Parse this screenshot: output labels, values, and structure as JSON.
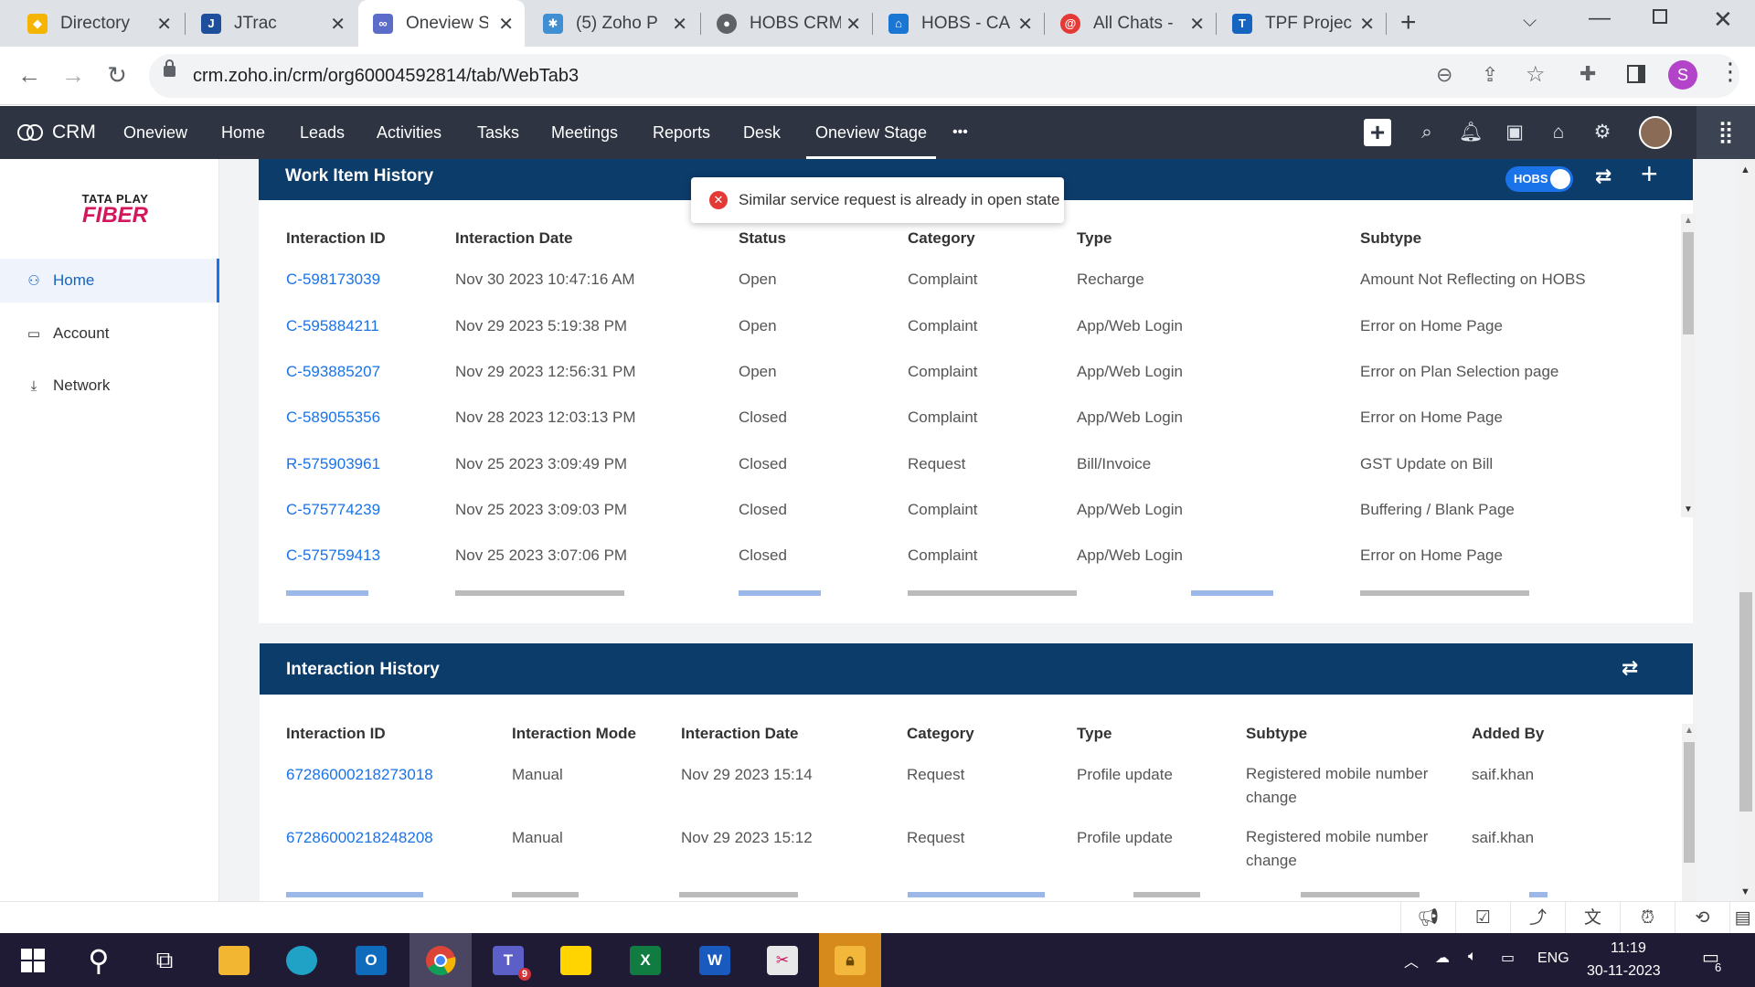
{
  "browser": {
    "tabs": [
      {
        "title": "Directory",
        "color": "#f4b400",
        "glyph": "◆"
      },
      {
        "title": "JTrac",
        "color": "#1e4f9c",
        "glyph": "J"
      },
      {
        "title": "Oneview S",
        "color": "#5b6cc9",
        "glyph": "∞",
        "active": true
      },
      {
        "title": "(5) Zoho P",
        "color": "#3f8fd2",
        "glyph": "✱"
      },
      {
        "title": "HOBS CRM",
        "color": "#5f6368",
        "glyph": "●"
      },
      {
        "title": "HOBS - CA",
        "color": "#1976d2",
        "glyph": "⌂"
      },
      {
        "title": "All Chats -",
        "color": "#e53935",
        "glyph": "@"
      },
      {
        "title": "TPF Projec",
        "color": "#1565c0",
        "glyph": "T"
      }
    ],
    "url": "crm.zoho.in/crm/org60004592814/tab/WebTab3",
    "profile_initial": "S"
  },
  "crm_nav": {
    "brand": "CRM",
    "items": [
      "Oneview",
      "Home",
      "Leads",
      "Activities",
      "Tasks",
      "Meetings",
      "Reports",
      "Desk",
      "Oneview Stage"
    ],
    "active": "Oneview Stage",
    "more": "•••"
  },
  "sidebar": {
    "logo_line1": "TATA PLAY",
    "logo_line2": "FIBER",
    "items": [
      {
        "label": "Home",
        "icon": "user-icon",
        "active": true
      },
      {
        "label": "Account",
        "icon": "account-icon"
      },
      {
        "label": "Network",
        "icon": "network-icon"
      }
    ]
  },
  "toast": {
    "message": "Similar service request is already in open state"
  },
  "work_item_history": {
    "title": "Work Item History",
    "toggle_label": "HOBS",
    "columns": [
      "Interaction ID",
      "Interaction Date",
      "Status",
      "Category",
      "Type",
      "Subtype"
    ],
    "rows": [
      {
        "id": "C-598173039",
        "date": "Nov 30 2023 10:47:16 AM",
        "status": "Open",
        "category": "Complaint",
        "type": "Recharge",
        "subtype": "Amount Not Reflecting on HOBS"
      },
      {
        "id": "C-595884211",
        "date": "Nov 29 2023 5:19:38 PM",
        "status": "Open",
        "category": "Complaint",
        "type": "App/Web Login",
        "subtype": "Error on Home Page"
      },
      {
        "id": "C-593885207",
        "date": "Nov 29 2023 12:56:31 PM",
        "status": "Open",
        "category": "Complaint",
        "type": "App/Web Login",
        "subtype": "Error on Plan Selection page"
      },
      {
        "id": "C-589055356",
        "date": "Nov 28 2023 12:03:13 PM",
        "status": "Closed",
        "category": "Complaint",
        "type": "App/Web Login",
        "subtype": "Error on Home Page"
      },
      {
        "id": "R-575903961",
        "date": "Nov 25 2023 3:09:49 PM",
        "status": "Closed",
        "category": "Request",
        "type": "Bill/Invoice",
        "subtype": "GST Update on Bill"
      },
      {
        "id": "C-575774239",
        "date": "Nov 25 2023 3:09:03 PM",
        "status": "Closed",
        "category": "Complaint",
        "type": "App/Web Login",
        "subtype": "Buffering / Blank Page"
      },
      {
        "id": "C-575759413",
        "date": "Nov 25 2023 3:07:06 PM",
        "status": "Closed",
        "category": "Complaint",
        "type": "App/Web Login",
        "subtype": "Error on Home Page"
      }
    ]
  },
  "interaction_history": {
    "title": "Interaction History",
    "columns": [
      "Interaction ID",
      "Interaction Mode",
      "Interaction Date",
      "Category",
      "Type",
      "Subtype",
      "Added By"
    ],
    "rows": [
      {
        "id": "67286000218273018",
        "mode": "Manual",
        "date": "Nov 29 2023 15:14",
        "category": "Request",
        "type": "Profile update",
        "subtype": "Registered mobile number change",
        "added_by": "saif.khan"
      },
      {
        "id": "67286000218248208",
        "mode": "Manual",
        "date": "Nov 29 2023 15:12",
        "category": "Request",
        "type": "Profile update",
        "subtype": "Registered mobile number change",
        "added_by": "saif.khan"
      }
    ]
  },
  "taskbar": {
    "language": "ENG",
    "time": "11:19",
    "date": "30-11-2023",
    "notifications": "6",
    "teams_badge": "9"
  }
}
